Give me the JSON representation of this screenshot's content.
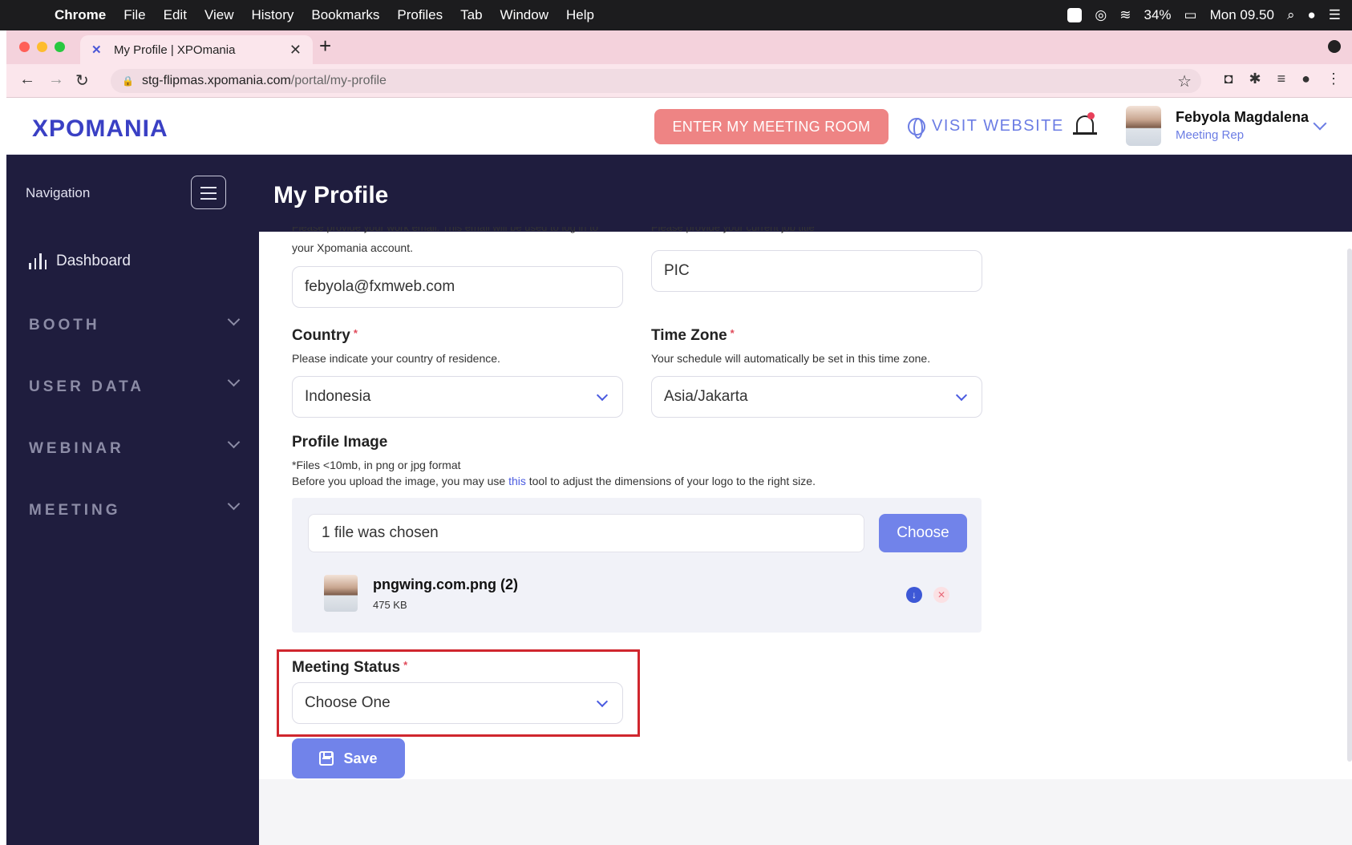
{
  "menubar": {
    "app": "Chrome",
    "items": [
      "File",
      "Edit",
      "View",
      "History",
      "Bookmarks",
      "Profiles",
      "Tab",
      "Window",
      "Help"
    ],
    "battery": "34%",
    "clock": "Mon 09.50"
  },
  "browser": {
    "tab_title": "My Profile | XPOmania",
    "url_host": "stg-flipmas.xpomania.com",
    "url_path": "/portal/my-profile"
  },
  "header": {
    "logo": "XPOMANIA",
    "meeting_button": "ENTER MY MEETING ROOM",
    "visit_link": "VISIT WEBSITE",
    "user_name": "Febyola Magdalena",
    "user_role": "Meeting Rep"
  },
  "sidebar": {
    "title": "Navigation",
    "dashboard": "Dashboard",
    "sections": [
      "BOOTH",
      "USER DATA",
      "WEBINAR",
      "MEETING"
    ]
  },
  "page": {
    "title": "My Profile"
  },
  "form": {
    "email_help_cut": "Please provide your work email. This email will be used to log in to",
    "email_help_cont": "your Xpomania account.",
    "email_value": "febyola@fxmweb.com",
    "job_help_cut": "Please provide your current job title",
    "job_value": "PIC",
    "country_label": "Country",
    "country_help": "Please indicate your country of residence.",
    "country_value": "Indonesia",
    "timezone_label": "Time Zone",
    "timezone_help": "Your schedule will automatically be set in this time zone.",
    "timezone_value": "Asia/Jakarta",
    "profile_image_label": "Profile Image",
    "profile_image_help1": "*Files <10mb, in png or jpg format",
    "profile_image_help2_pre": "Before you upload the image, you may use ",
    "profile_image_help2_link": "this",
    "profile_image_help2_post": " tool to adjust the dimensions of your logo to the right size.",
    "file_status": "1 file was chosen",
    "choose_button": "Choose",
    "file_name": "pngwing.com.png (2)",
    "file_size": "475 KB",
    "meeting_status_label": "Meeting Status",
    "meeting_status_value": "Choose One",
    "required_mark": "*",
    "save_button": "Save"
  }
}
